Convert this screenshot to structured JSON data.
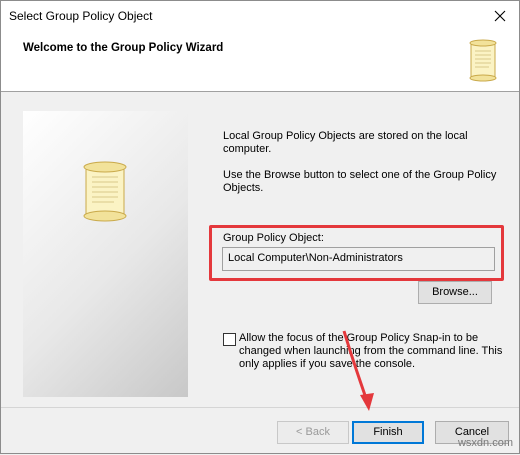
{
  "window": {
    "title": "Select Group Policy Object",
    "close_icon": "close-icon"
  },
  "header": {
    "title": "Welcome to the Group Policy Wizard",
    "icon": "scroll-icon"
  },
  "body": {
    "info_line1": "Local Group Policy Objects are stored on the local computer.",
    "info_line2": "Use the Browse button to select one of the Group Policy Objects.",
    "gpo_label": "Group Policy Object:",
    "gpo_value": "Local Computer\\Non-Administrators",
    "browse_label": "Browse...",
    "allow_focus_text": "Allow the focus of the Group Policy Snap-in to be changed when launching from the command line.  This only applies if you save the console.",
    "allow_focus_checked": false
  },
  "footer": {
    "back_label": "< Back",
    "finish_label": "Finish",
    "cancel_label": "Cancel"
  },
  "annotations": {
    "highlight_color": "#e4383c",
    "watermark": "wsxdn.com"
  }
}
